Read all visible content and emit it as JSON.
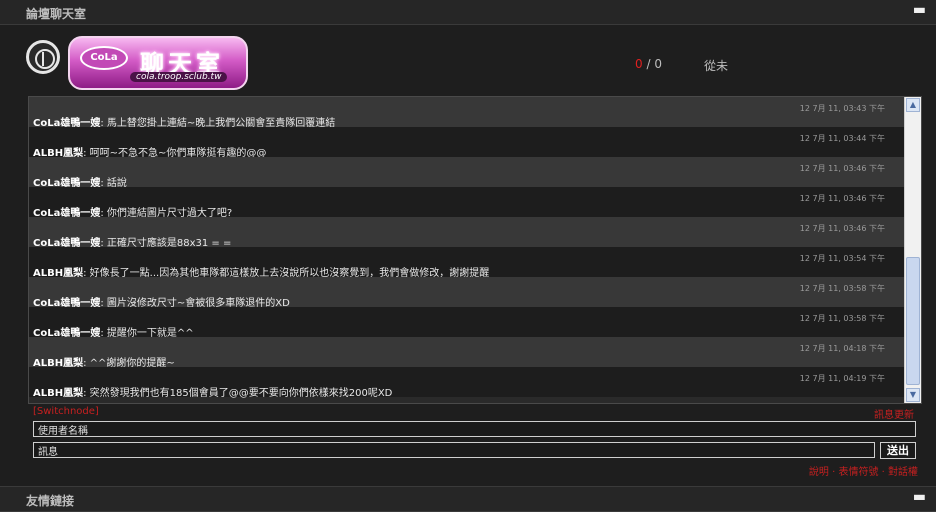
{
  "chat_panel": {
    "title": "論壇聊天室",
    "collapse_symbol": "▬"
  },
  "logo": {
    "cola_text": "CoLa",
    "room_text": "聊天室",
    "url_text": "cola.troop.sclub.tw"
  },
  "status": {
    "current": "0",
    "separator": "/",
    "total": "0",
    "from_label": "從未"
  },
  "messages": [
    {
      "time": "12 7月 11, 03:43 下午",
      "user": "CoLa雄鴨一嫂",
      "text": ": 馬上替您掛上連結~晚上我們公關會至貴隊回覆連結"
    },
    {
      "time": "12 7月 11, 03:44 下午",
      "user": "ALBH凰梨",
      "text": ": 呵呵~不急不急~你們車隊挺有趣的@@"
    },
    {
      "time": "12 7月 11, 03:46 下午",
      "user": "CoLa雄鴨一嫂",
      "text": ": 話說"
    },
    {
      "time": "12 7月 11, 03:46 下午",
      "user": "CoLa雄鴨一嫂",
      "text": ": 你們連結圖片尺寸過大了吧?"
    },
    {
      "time": "12 7月 11, 03:46 下午",
      "user": "CoLa雄鴨一嫂",
      "text": ": 正確尺寸應該是88x31 = ="
    },
    {
      "time": "12 7月 11, 03:54 下午",
      "user": "ALBH凰梨",
      "text": ": 好像長了一點...因為其他車隊都這樣放上去沒說所以也沒察覺到，我們會做修改，謝謝提醒"
    },
    {
      "time": "12 7月 11, 03:58 下午",
      "user": "CoLa雄鴨一嫂",
      "text": ": 圖片沒修改尺寸~會被很多車隊退件的XD"
    },
    {
      "time": "12 7月 11, 03:58 下午",
      "user": "CoLa雄鴨一嫂",
      "text": ": 提醒你一下就是^^"
    },
    {
      "time": "12 7月 11, 04:18 下午",
      "user": "ALBH凰梨",
      "text": ": ^^謝謝你的提醒~"
    },
    {
      "time": "12 7月 11, 04:19 下午",
      "user": "ALBH凰梨",
      "text": ": 突然發現我們也有185個會員了@@要不要向你們依樣來找200呢XD"
    }
  ],
  "controls": {
    "switchnode": "[Switchnode]",
    "update_label": "訊息更新",
    "username_value": "使用者名稱",
    "message_value": "訊息",
    "send_label": "送出",
    "help_link": "說明",
    "emoticon_link": "表情符號",
    "permission_link": "對話權",
    "link_separator": " · "
  },
  "links_panel": {
    "title": "友情鏈接",
    "collapse_symbol": "▬"
  }
}
